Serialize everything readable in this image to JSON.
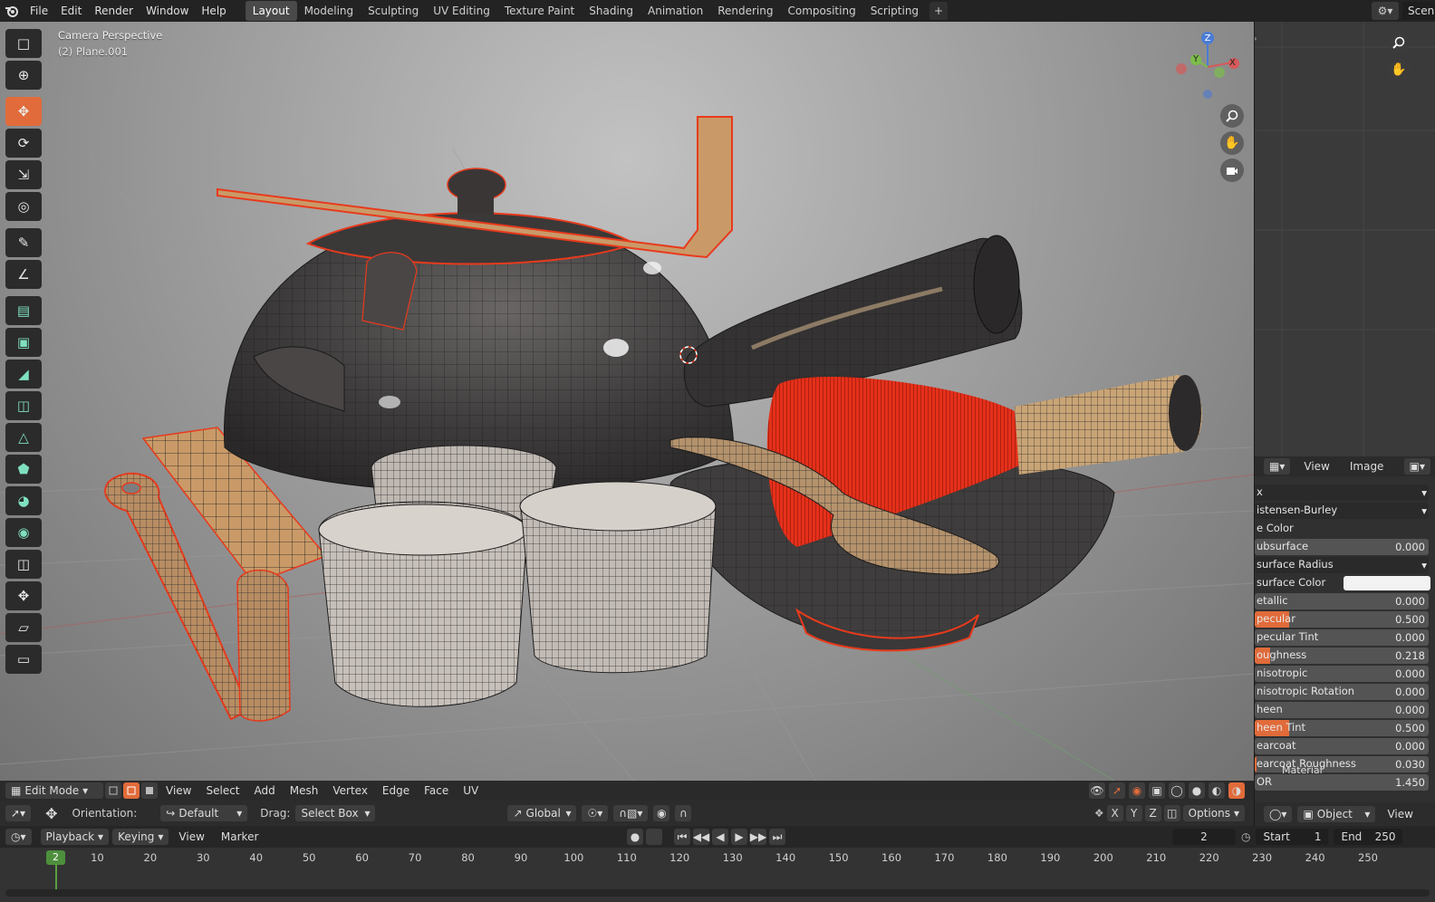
{
  "menubar": {
    "items": [
      "File",
      "Edit",
      "Render",
      "Window",
      "Help"
    ],
    "workspaces": [
      "Layout",
      "Modeling",
      "Sculpting",
      "UV Editing",
      "Texture Paint",
      "Shading",
      "Animation",
      "Rendering",
      "Compositing",
      "Scripting"
    ],
    "active_workspace": "Layout",
    "add_symbol": "+",
    "scene_label": "Scen"
  },
  "viewport": {
    "camera_label": "Camera Perspective",
    "object_label": "(2) Plane.001",
    "gizmo": {
      "x": "X",
      "y": "Y",
      "z": "Z"
    },
    "tools": [
      "select-box-icon",
      "cursor-icon",
      "move-icon",
      "rotate-icon",
      "scale-icon",
      "transform-icon",
      "annotate-icon",
      "measure-icon",
      "extrude-icon",
      "inset-icon",
      "bevel-icon",
      "loop-cut-icon",
      "knife-icon",
      "poly-build-icon",
      "spin-icon",
      "smooth-icon",
      "edge-slide-icon",
      "shrink-fatten-icon",
      "shear-icon",
      "rip-icon"
    ],
    "active_tool": "move-icon"
  },
  "viewport_header": {
    "mode": "Edit Mode",
    "menus": [
      "View",
      "Select",
      "Add",
      "Mesh",
      "Vertex",
      "Edge",
      "Face",
      "UV"
    ]
  },
  "tool_settings": {
    "orientation_label": "Orientation:",
    "orientation_value": "Default",
    "drag_label": "Drag:",
    "drag_value": "Select Box",
    "transform_orientation": "Global",
    "axes": [
      "X",
      "Y",
      "Z"
    ],
    "options_label": "Options",
    "object_label": "Object"
  },
  "image_editor": {
    "menus": [
      "View",
      "Image"
    ]
  },
  "properties": {
    "rows": [
      {
        "label": "x",
        "type": "dropdown"
      },
      {
        "label": "istensen-Burley",
        "type": "dropdown"
      },
      {
        "label": "e Color",
        "type": "text"
      },
      {
        "label": "ubsurface",
        "value": "0.000",
        "fill": 0
      },
      {
        "label": "surface Radius",
        "type": "dropdown"
      },
      {
        "label": "surface Color",
        "type": "color"
      },
      {
        "label": "etallic",
        "value": "0.000",
        "fill": 0
      },
      {
        "label": "pecular",
        "value": "0.500",
        "fill": 0.5
      },
      {
        "label": "pecular Tint",
        "value": "0.000",
        "fill": 0
      },
      {
        "label": "oughness",
        "value": "0.218",
        "fill": 0.218
      },
      {
        "label": "nisotropic",
        "value": "0.000",
        "fill": 0
      },
      {
        "label": "nisotropic Rotation",
        "value": "0.000",
        "fill": 0
      },
      {
        "label": "heen",
        "value": "0.000",
        "fill": 0
      },
      {
        "label": "heen Tint",
        "value": "0.500",
        "fill": 0.5
      },
      {
        "label": "earcoat",
        "value": "0.000",
        "fill": 0
      },
      {
        "label": "earcoat Roughness",
        "value": "0.030",
        "fill": 0.03
      },
      {
        "label": "OR",
        "value": "1.450",
        "fill": 0
      }
    ],
    "overlay_label": "Material"
  },
  "timeline": {
    "menus": [
      "Playback",
      "Keying",
      "View",
      "Marker"
    ],
    "current_frame": "2",
    "start_label": "Start",
    "start_value": "1",
    "end_label": "End",
    "end_value": "250",
    "ticks": [
      "10",
      "20",
      "30",
      "40",
      "50",
      "60",
      "70",
      "80",
      "90",
      "100",
      "110",
      "120",
      "130",
      "140",
      "150",
      "160",
      "170",
      "180",
      "190",
      "200",
      "210",
      "220",
      "230",
      "240",
      "250"
    ]
  },
  "colors": {
    "accent": "#e16b3a",
    "selection": "#e83a1c",
    "frame_green": "#4d8f3d"
  }
}
